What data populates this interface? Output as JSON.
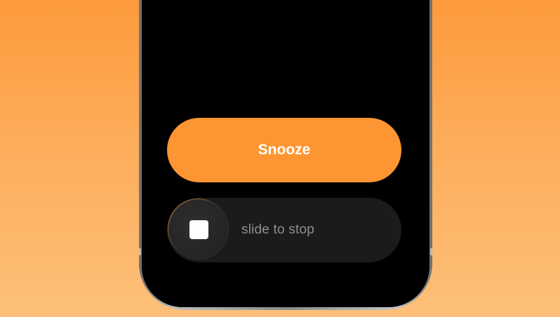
{
  "colors": {
    "background_top": "#fd9a3c",
    "background_bottom": "#fdc07a",
    "accent": "#fd9632",
    "screen": "#000000",
    "slider_track": "#1b1b1b",
    "slider_text": "#8f8f8f"
  },
  "alarm": {
    "snooze_label": "Snooze",
    "slider_label": "slide to stop",
    "slider_icon": "stop-icon"
  }
}
